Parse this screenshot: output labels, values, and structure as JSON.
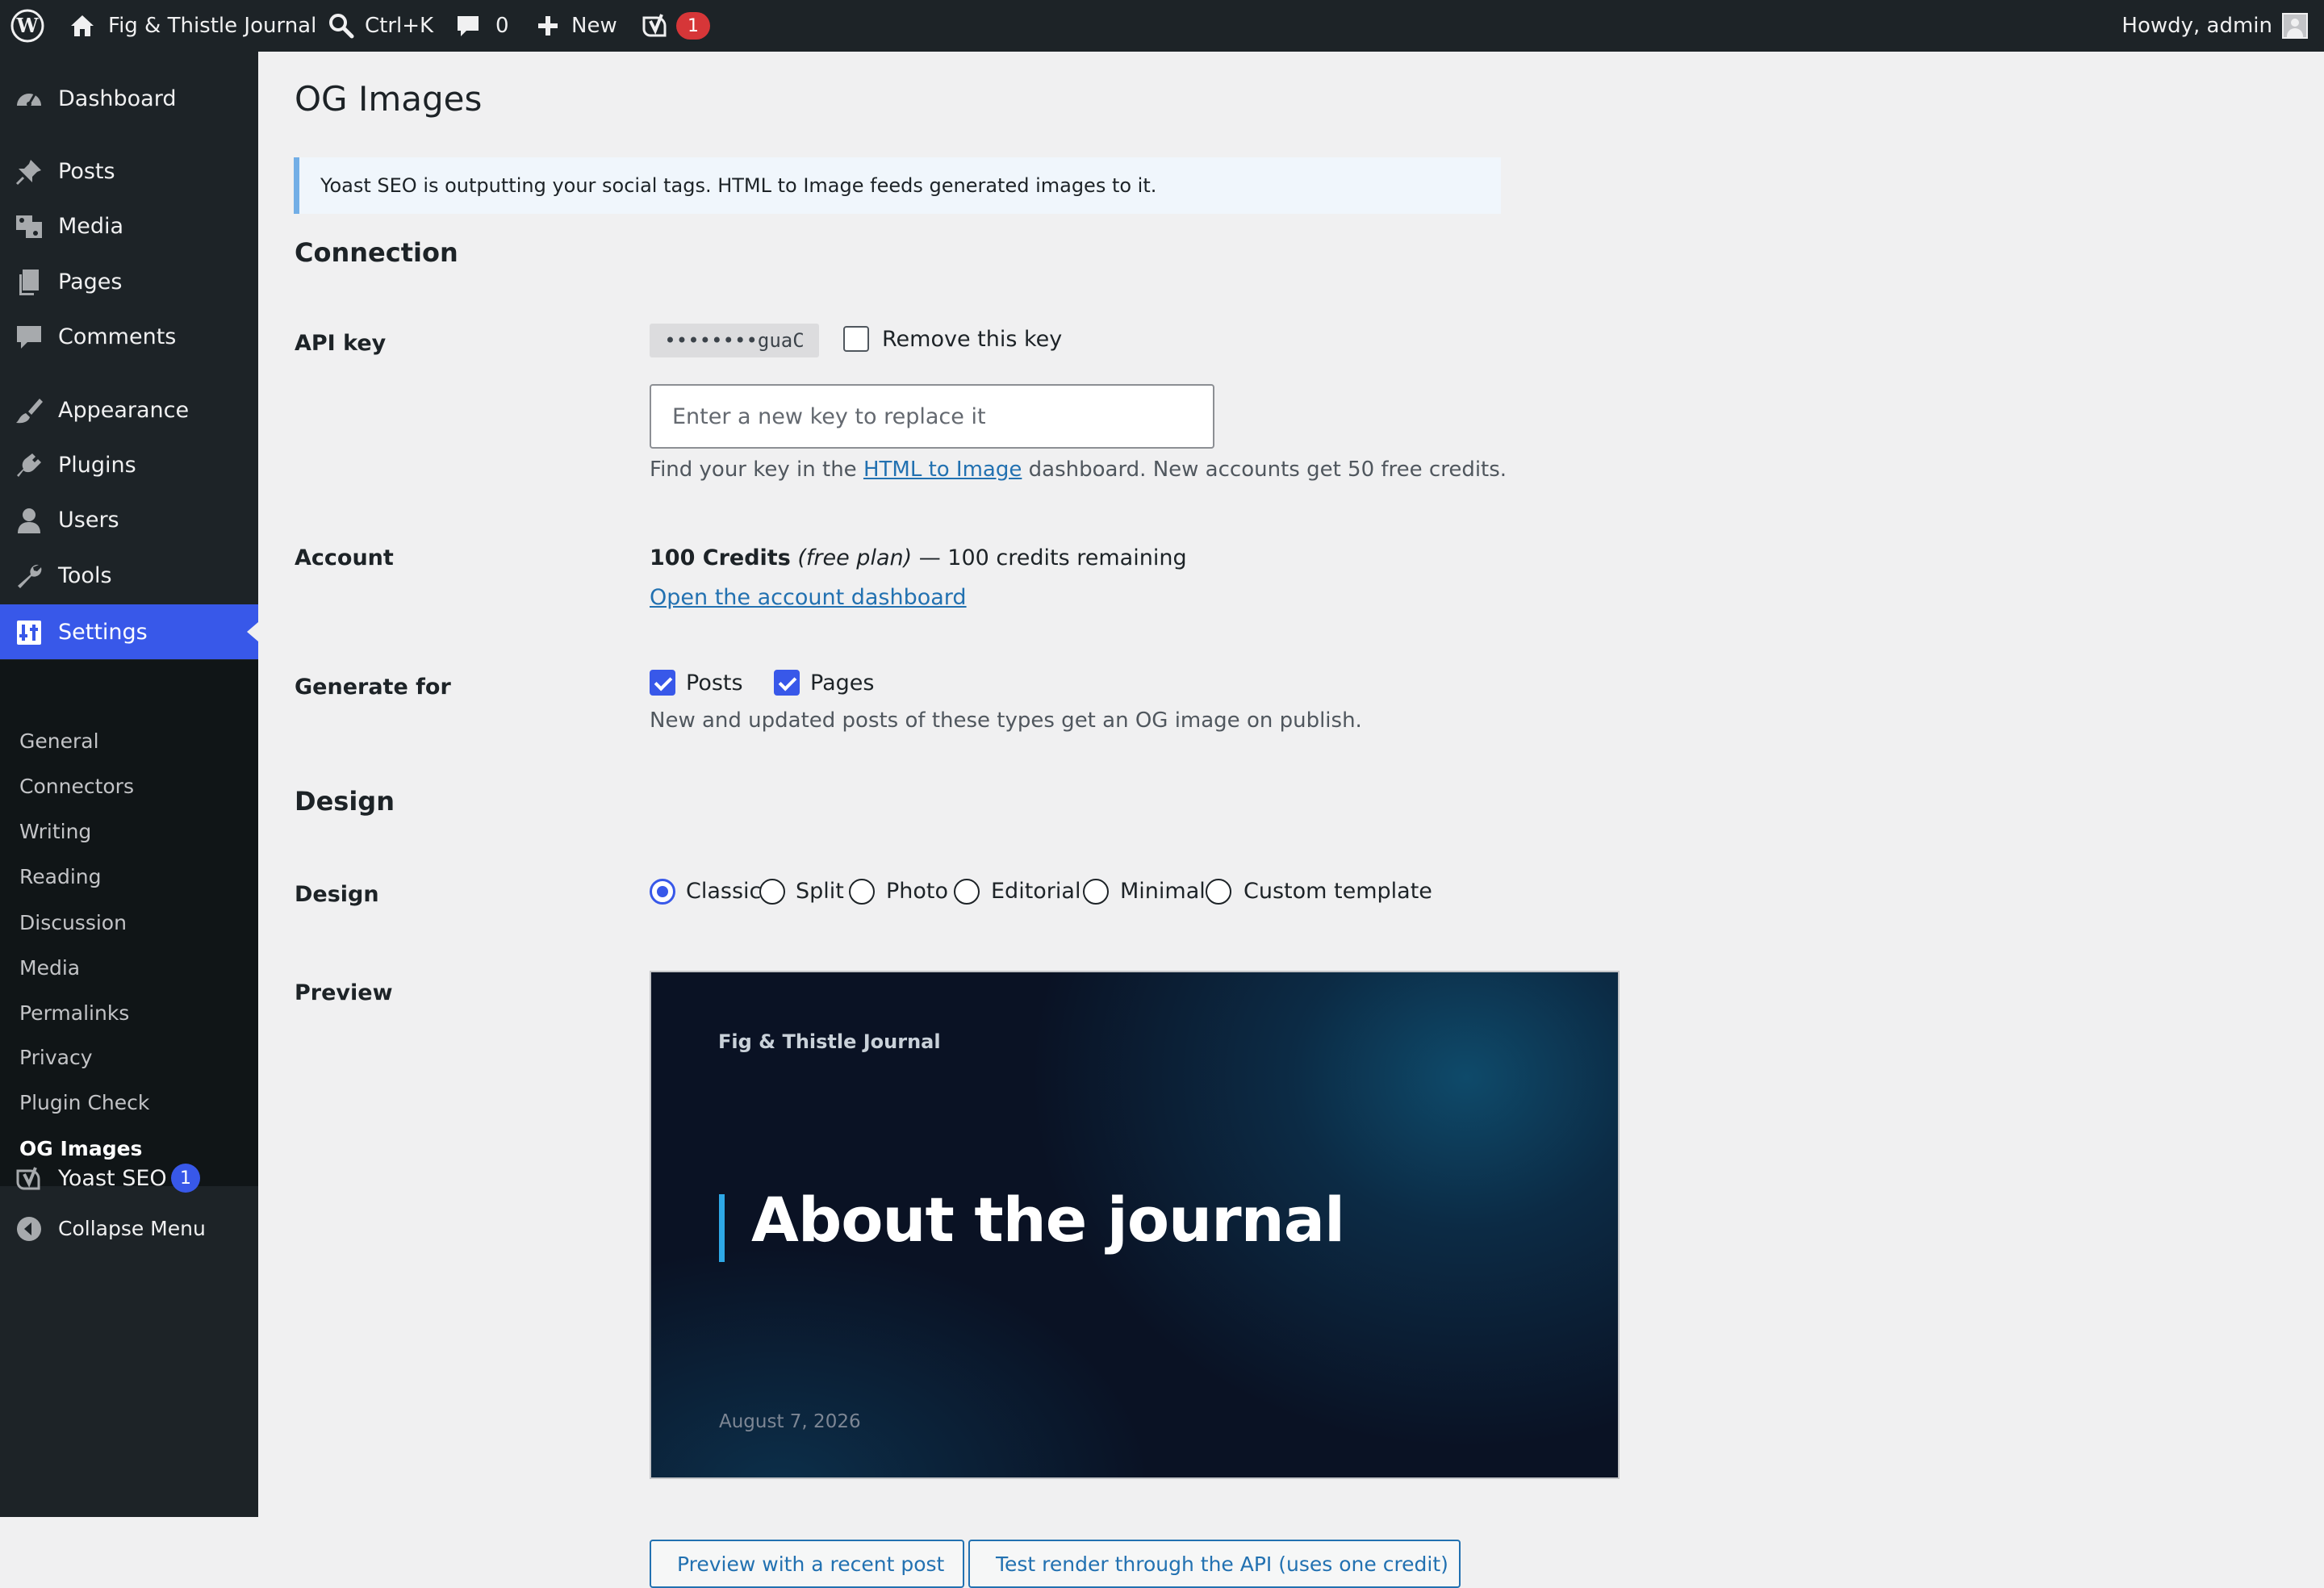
{
  "adminbar": {
    "site_name": "Fig & Thistle Journal",
    "search_shortcut": "Ctrl+K",
    "comments_count": "0",
    "new_label": "New",
    "yoast_badge": "1",
    "howdy": "Howdy, admin"
  },
  "sidebar": {
    "items": [
      {
        "label": "Dashboard"
      },
      {
        "label": "Posts"
      },
      {
        "label": "Media"
      },
      {
        "label": "Pages"
      },
      {
        "label": "Comments"
      },
      {
        "label": "Appearance"
      },
      {
        "label": "Plugins"
      },
      {
        "label": "Users"
      },
      {
        "label": "Tools"
      },
      {
        "label": "Settings"
      }
    ],
    "submenu": [
      {
        "label": "General"
      },
      {
        "label": "Connectors"
      },
      {
        "label": "Writing"
      },
      {
        "label": "Reading"
      },
      {
        "label": "Discussion"
      },
      {
        "label": "Media"
      },
      {
        "label": "Permalinks"
      },
      {
        "label": "Privacy"
      },
      {
        "label": "Plugin Check"
      },
      {
        "label": "OG Images"
      }
    ],
    "yoast": {
      "label": "Yoast SEO",
      "badge": "1"
    },
    "collapse": "Collapse Menu"
  },
  "page": {
    "title": "OG Images",
    "notice": "Yoast SEO is outputting your social tags. HTML to Image feeds generated images to it."
  },
  "connection": {
    "title": "Connection",
    "api_key": {
      "label": "API key",
      "masked": "••••••••guaC",
      "remove_label": "Remove this key",
      "placeholder": "Enter a new key to replace it",
      "help_prefix": "Find your key in the ",
      "help_link": "HTML to Image",
      "help_suffix": " dashboard. New accounts get 50 free credits."
    },
    "account": {
      "label": "Account",
      "plan": "100 Credits",
      "plan_type": "(free plan)",
      "remaining": " — 100 credits remaining",
      "dashboard_link": "Open the account dashboard"
    },
    "generate_for": {
      "label": "Generate for",
      "options": [
        {
          "label": "Posts",
          "checked": true
        },
        {
          "label": "Pages",
          "checked": true
        }
      ],
      "help": "New and updated posts of these types get an OG image on publish."
    }
  },
  "design": {
    "title": "Design",
    "design_label": "Design",
    "options": [
      {
        "label": "Classic",
        "selected": true
      },
      {
        "label": "Split",
        "selected": false
      },
      {
        "label": "Photo",
        "selected": false
      },
      {
        "label": "Editorial",
        "selected": false
      },
      {
        "label": "Minimal",
        "selected": false
      },
      {
        "label": "Custom template",
        "selected": false
      }
    ],
    "preview_label": "Preview",
    "preview": {
      "site": "Fig & Thistle Journal",
      "title": "About the journal",
      "date": "August 7, 2026"
    },
    "buttons": {
      "preview_recent": "Preview with a recent post",
      "test_render": "Test render through the API (uses one credit)"
    }
  },
  "colors": {
    "accent": "#3858e9",
    "adminbar_bg": "#1d2327",
    "badge_red": "#d63638",
    "link": "#2271b1"
  }
}
